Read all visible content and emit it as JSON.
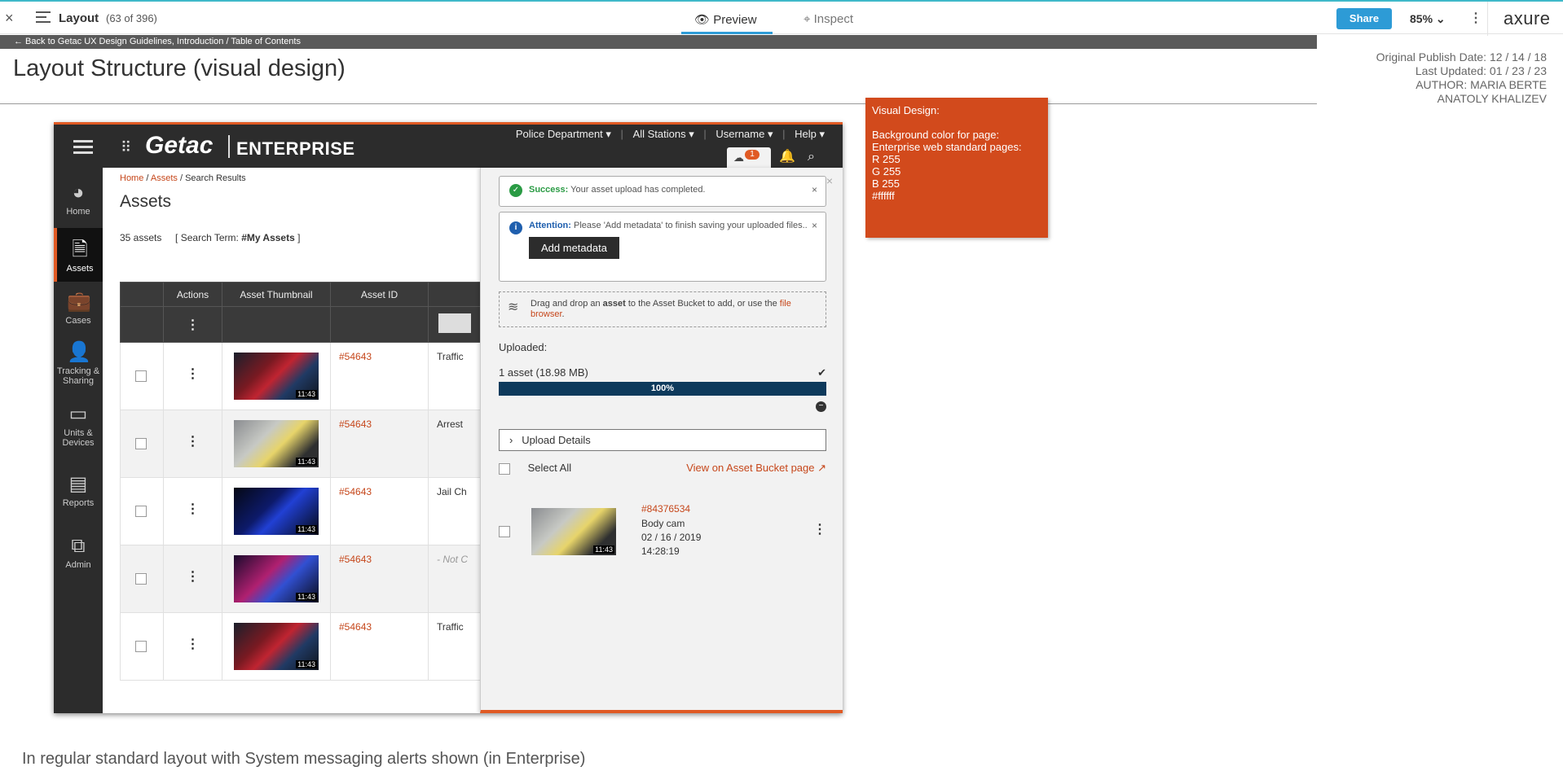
{
  "toolbar": {
    "close": "×",
    "title": "Layout",
    "page_count": "(63 of 396)",
    "preview_label": "Preview",
    "inspect_label": "Inspect",
    "share_label": "Share",
    "zoom": "85%",
    "logo": "axure"
  },
  "back_link": "← Back to Getac UX Design Guidelines, Introduction / Table of Contents",
  "page_title": "Layout Structure (visual design)",
  "meta": {
    "publish": "Original Publish Date: 12 / 14 / 18",
    "updated": "Last Updated:  01 / 23 / 23",
    "author": "AUTHOR: MARIA BERTE",
    "author2": "ANATOLY KHALIZEV"
  },
  "note": {
    "title": "Visual Design:",
    "line1": "Background color for page:",
    "line2": "Enterprise web standard pages:",
    "r": "R 255",
    "g": "G 255",
    "b": "B 255",
    "hex": "#ffffff"
  },
  "caption": "In regular standard layout with System messaging alerts shown (in Enterprise)",
  "enterprise": {
    "brand": "Getac",
    "brand_sub": "ENTERPRISE",
    "topnav": [
      "Police Department ▾",
      "All Stations ▾",
      "Username ▾",
      "Help ▾"
    ],
    "badge": "1",
    "sidebar": [
      {
        "label": "Home"
      },
      {
        "label": "Assets"
      },
      {
        "label": "Cases"
      },
      {
        "label": "Tracking & Sharing"
      },
      {
        "label": "Units & Devices"
      },
      {
        "label": "Reports"
      },
      {
        "label": "Admin"
      }
    ],
    "breadcrumb": {
      "home": "Home",
      "assets": "Assets",
      "current": "Search Results"
    },
    "heading": "Assets",
    "count": "35 assets",
    "search_term_prefix": "[ Search Term: ",
    "search_term": "#My Assets",
    "search_term_suffix": " ]",
    "columns": [
      "Actions",
      "Asset Thumbnail",
      "Asset ID"
    ],
    "rows": [
      {
        "time": "11:43",
        "id": "#54643",
        "desc": "Traffic"
      },
      {
        "time": "11:43",
        "id": "#54643",
        "desc": "Arrest"
      },
      {
        "time": "11:43",
        "id": "#54643",
        "desc": "Jail Ch"
      },
      {
        "time": "11:43",
        "id": "#54643",
        "desc": "- Not C"
      },
      {
        "time": "11:43",
        "id": "#54643",
        "desc": "Traffic"
      }
    ]
  },
  "panel": {
    "success_title": "Success:",
    "success_msg": "Your asset upload has completed.",
    "attention_title": "Attention:",
    "attention_msg": "Please 'Add metadata' to finish saving your uploaded files..",
    "add_metadata": "Add metadata",
    "drop_pre": "Drag and drop an ",
    "drop_bold": "asset",
    "drop_mid": " to the Asset Bucket to add, or use the ",
    "drop_link": "file browser",
    "drop_end": ".",
    "uploaded": "Uploaded:",
    "asset_summary": "1 asset (18.98 MB)",
    "progress": "100%",
    "progress_value": 100,
    "upload_details": "Upload Details",
    "select_all": "Select All",
    "view_bucket": "View on Asset Bucket page ↗",
    "item": {
      "id": "#84376534",
      "type": "Body cam",
      "date": "02 / 16 / 2019",
      "time": "14:28:19",
      "thumb_time": "11:43"
    }
  }
}
